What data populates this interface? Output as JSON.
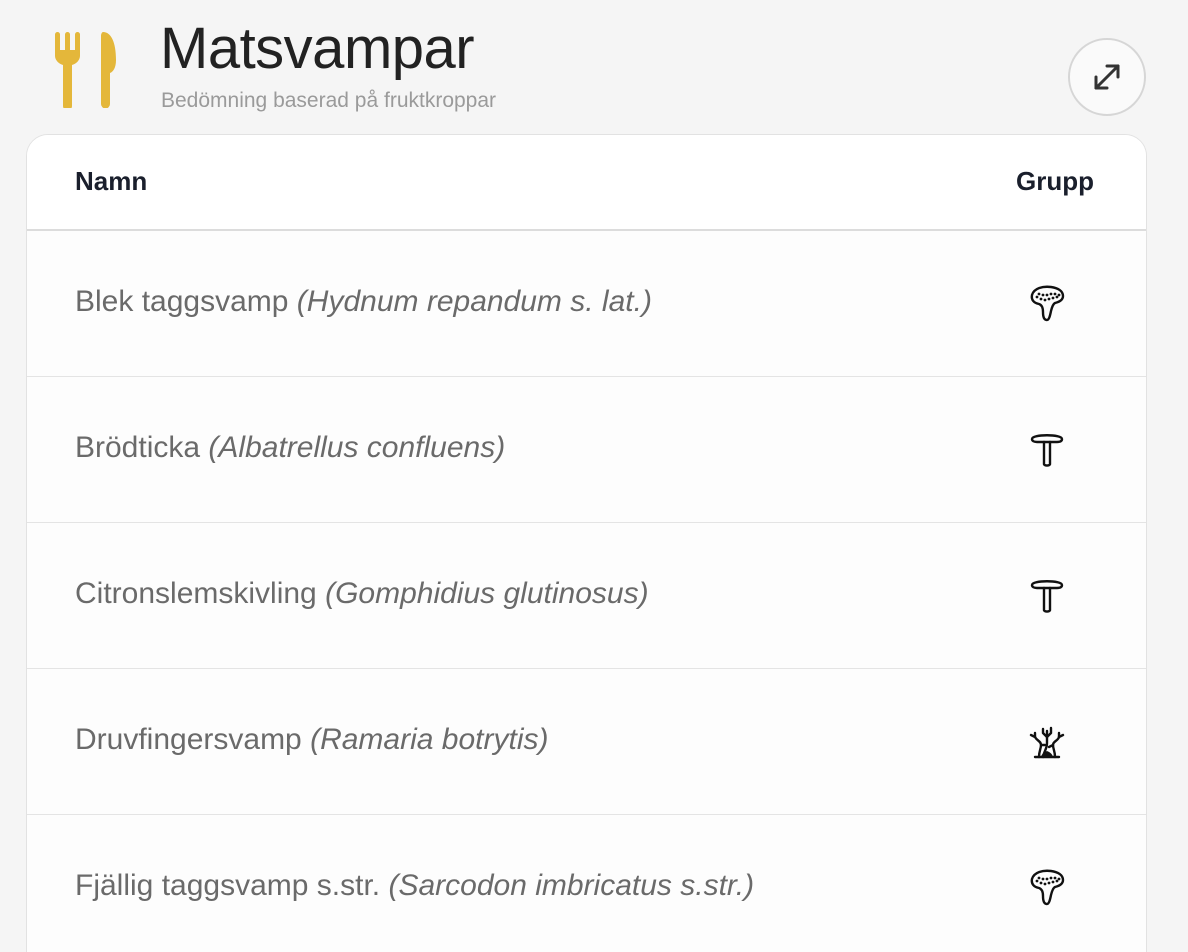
{
  "header": {
    "title": "Matsvampar",
    "subtitle": "Bedömning baserad på fruktkroppar",
    "app_icon": "fork-knife-icon",
    "expand_icon": "expand-arrows-icon",
    "accent_color": "#E4B73A"
  },
  "table": {
    "columns": [
      "Namn",
      "Grupp"
    ],
    "rows": [
      {
        "common": "Blek taggsvamp",
        "latin": "(Hydnum repandum s. lat.)",
        "group_icon": "tooth-fungus-icon"
      },
      {
        "common": "Brödticka",
        "latin": "(Albatrellus confluens)",
        "group_icon": "cap-mushroom-icon"
      },
      {
        "common": "Citronslemskivling",
        "latin": "(Gomphidius glutinosus)",
        "group_icon": "cap-mushroom-icon"
      },
      {
        "common": "Druvfingersvamp",
        "latin": "(Ramaria botrytis)",
        "group_icon": "coral-fungus-icon"
      },
      {
        "common": "Fjällig taggsvamp s.str.",
        "latin": "(Sarcodon imbricatus s.str.)",
        "group_icon": "tooth-fungus-icon"
      }
    ]
  }
}
